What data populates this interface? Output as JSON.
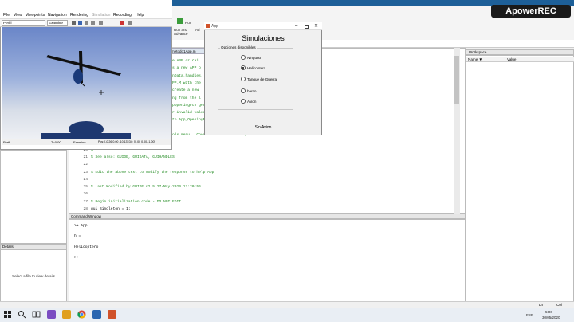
{
  "flightgear": {
    "menus": [
      "File",
      "View",
      "Viewpoints",
      "Navigation",
      "Rendering",
      "Simulation",
      "Recording",
      "Help"
    ],
    "toolbar_combo1": "Perfil",
    "toolbar_combo2": "Examine",
    "status_left": "Perfil",
    "status_mid": "T=0.00",
    "status_mode": "Examine",
    "status_pos": "Pos: [-0.26 0.00 -10.13] Dir: [0.00 0.00 -1.00]"
  },
  "editor": {
    "tab_label": "metodo1App.m",
    "lines": [
      {
        "num": "",
        "text": "e APP or rai"
      },
      {
        "num": "",
        "text": "s a new APP o"
      },
      {
        "num": "",
        "text": "nData,handles,"
      },
      {
        "num": "",
        "text": "PP.M with the"
      },
      {
        "num": "",
        "text": "create a new"
      },
      {
        "num": "",
        "text": "ng from the l"
      },
      {
        "num": "",
        "text": "pOpeningFcn gets called.  An"
      },
      {
        "num": "",
        "text": "r invalid value makes property application"
      },
      {
        "num": "",
        "text": "to App_OpeningFcn via varargin."
      },
      {
        "num": "17",
        "text": "%"
      },
      {
        "num": "18",
        "text": "%      *See GUI Options on GUIDE's Tools menu.  Choose \"GUI allows only one"
      },
      {
        "num": "19",
        "text": "%      instance to run (singleton)\"."
      },
      {
        "num": "20",
        "text": "%"
      },
      {
        "num": "21",
        "text": "% See also: GUIDE, GUIDATA, GUIHANDLES"
      },
      {
        "num": "22",
        "text": ""
      },
      {
        "num": "23",
        "text": "% Edit the above text to modify the response to help App"
      },
      {
        "num": "24",
        "text": ""
      },
      {
        "num": "25",
        "text": "% Last Modified by GUIDE v2.5 27-May-2020 17:20:56"
      },
      {
        "num": "26",
        "text": ""
      },
      {
        "num": "27",
        "text": "% Begin initialization code - DO NOT EDIT"
      },
      {
        "num": "28",
        "text": "gui_Singleton = 1;"
      }
    ]
  },
  "command_window": {
    "header": "Command Window",
    "lines": [
      ">> App",
      "h =",
      "Helicoptero",
      ">>"
    ]
  },
  "details": {
    "header": "Details",
    "placeholder": "Select a file to view details"
  },
  "workspace": {
    "header": "Workspace",
    "col_name": "Name ▼",
    "col_value": "Value"
  },
  "ribbon": {
    "run_label": "Run",
    "run_advance_label": "Run and Advance",
    "add_label": "Ad"
  },
  "app_dialog": {
    "title": "App",
    "heading": "Simulaciones",
    "group_label": "Opciones disponibles",
    "options": [
      {
        "label": "Ninguno",
        "selected": false
      },
      {
        "label": "Helicoptero",
        "selected": true
      },
      {
        "label": "Tanque de Guerra",
        "selected": false
      },
      {
        "label": "barco",
        "selected": false
      },
      {
        "label": "Avion",
        "selected": false
      }
    ],
    "status": "Sin Avion"
  },
  "statusbar": {
    "ln": "Ln",
    "col": "Col"
  },
  "taskbar": {
    "lang": "ESP",
    "time": "5:06",
    "date": "30/05/2020"
  },
  "logo": "ApowerREC"
}
